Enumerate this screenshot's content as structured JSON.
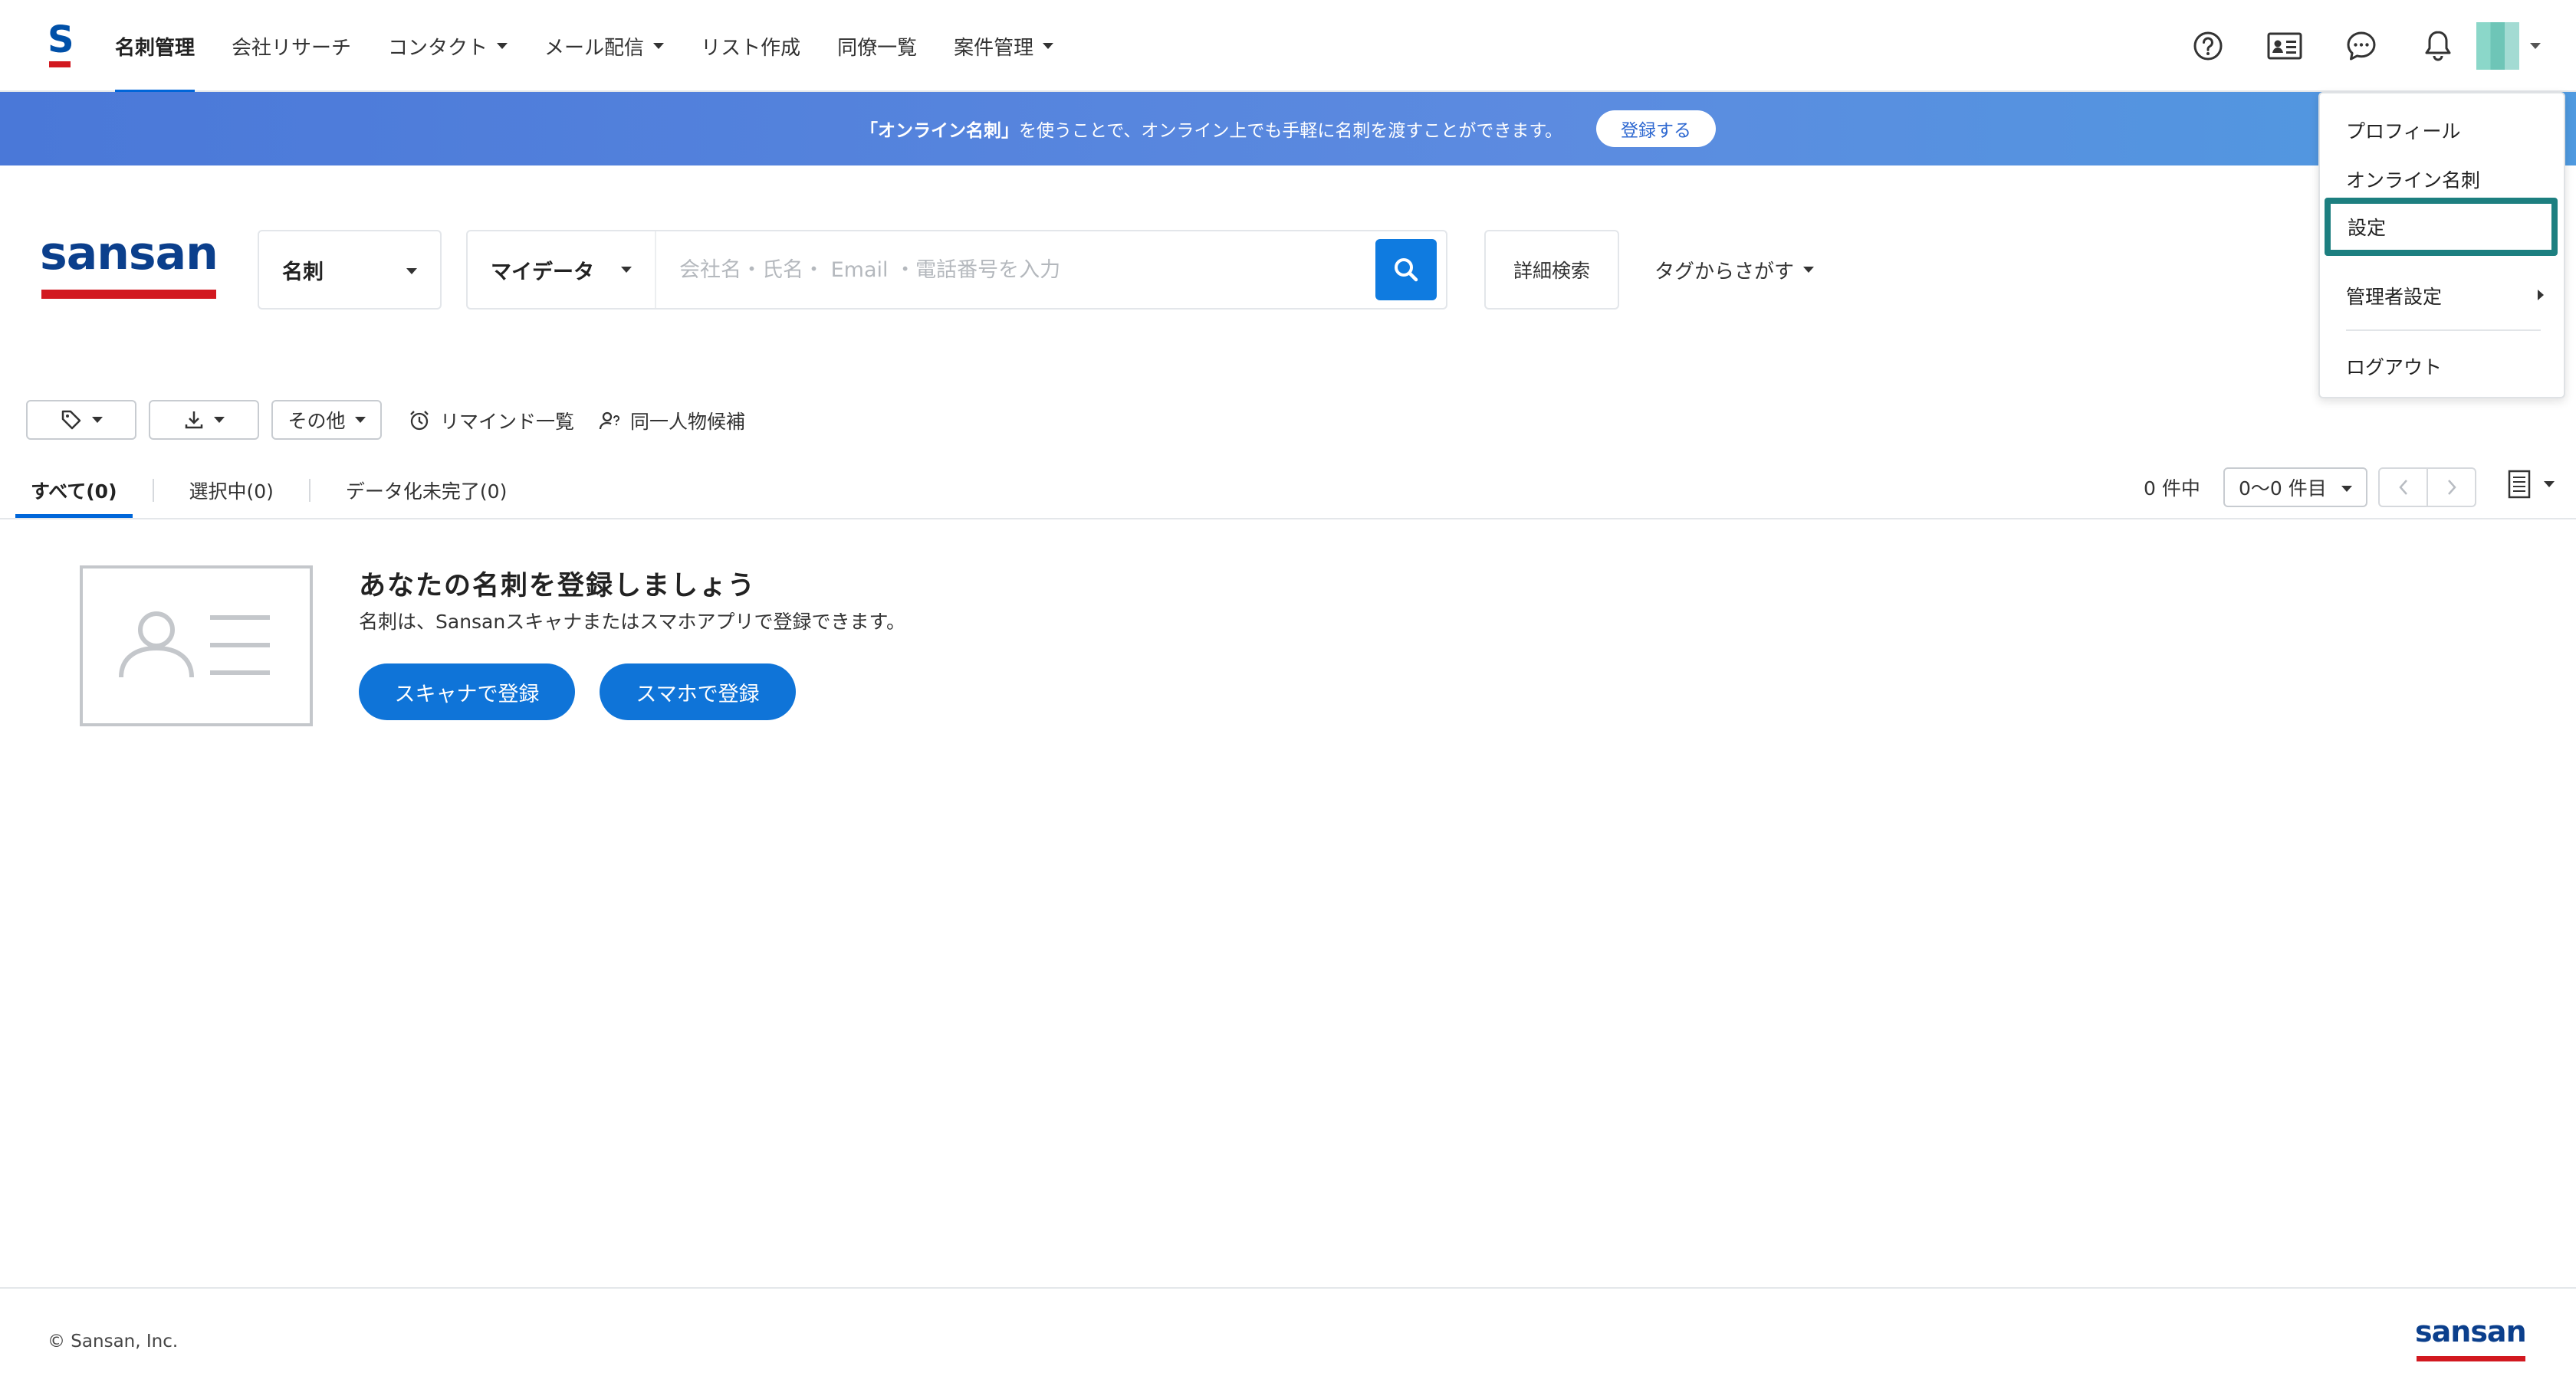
{
  "nav": {
    "items": [
      {
        "label": "名刺管理",
        "active": true,
        "has_caret": false
      },
      {
        "label": "会社リサーチ",
        "active": false,
        "has_caret": false
      },
      {
        "label": "コンタクト",
        "active": false,
        "has_caret": true
      },
      {
        "label": "メール配信",
        "active": false,
        "has_caret": true
      },
      {
        "label": "リスト作成",
        "active": false,
        "has_caret": false
      },
      {
        "label": "同僚一覧",
        "active": false,
        "has_caret": false
      },
      {
        "label": "案件管理",
        "active": false,
        "has_caret": true
      }
    ],
    "icons": [
      "help-icon",
      "contact-card-icon",
      "chat-icon",
      "bell-icon"
    ]
  },
  "banner": {
    "highlight": "「オンライン名刺」",
    "text": "を使うことで、オンライン上でも手軽に名刺を渡すことができます。",
    "button": "登録する"
  },
  "search": {
    "type_label": "名刺",
    "scope_label": "マイデータ",
    "placeholder": "会社名・氏名・ Email ・電話番号を入力",
    "value": "",
    "detail_label": "詳細検索",
    "tag_label": "タグからさがす"
  },
  "toolbar": {
    "other_label": "その他",
    "reminder_label": "リマインド一覧",
    "same_person_label": "同一人物候補"
  },
  "tabs": [
    {
      "label": "すべて(0)",
      "active": true
    },
    {
      "label": "選択中(0)",
      "active": false
    },
    {
      "label": "データ化未完了(0)",
      "active": false
    }
  ],
  "pagination": {
    "count_label": "0 件中",
    "range_label": "0〜0 件目"
  },
  "empty_state": {
    "title": "あなたの名刺を登録しましょう",
    "subtitle": "名刺は、Sansanスキャナまたはスマホアプリで登録できます。",
    "scanner_button": "スキャナで登録",
    "phone_button": "スマホで登録"
  },
  "footer": {
    "copyright": "© Sansan, Inc.",
    "logo_text": "sansan"
  },
  "brand": {
    "logo_text": "sansan",
    "small_logo_letter": "S"
  },
  "user_menu": {
    "items": [
      "プロフィール",
      "オンライン名刺",
      "設定",
      "管理者設定",
      "ログアウト"
    ],
    "highlighted": "設定"
  },
  "colors": {
    "accent": "#0066d9",
    "button": "#0f74d8",
    "brand_red": "#d21920",
    "brand_blue": "#0b3f8c",
    "highlight_border": "#1d7f80"
  }
}
